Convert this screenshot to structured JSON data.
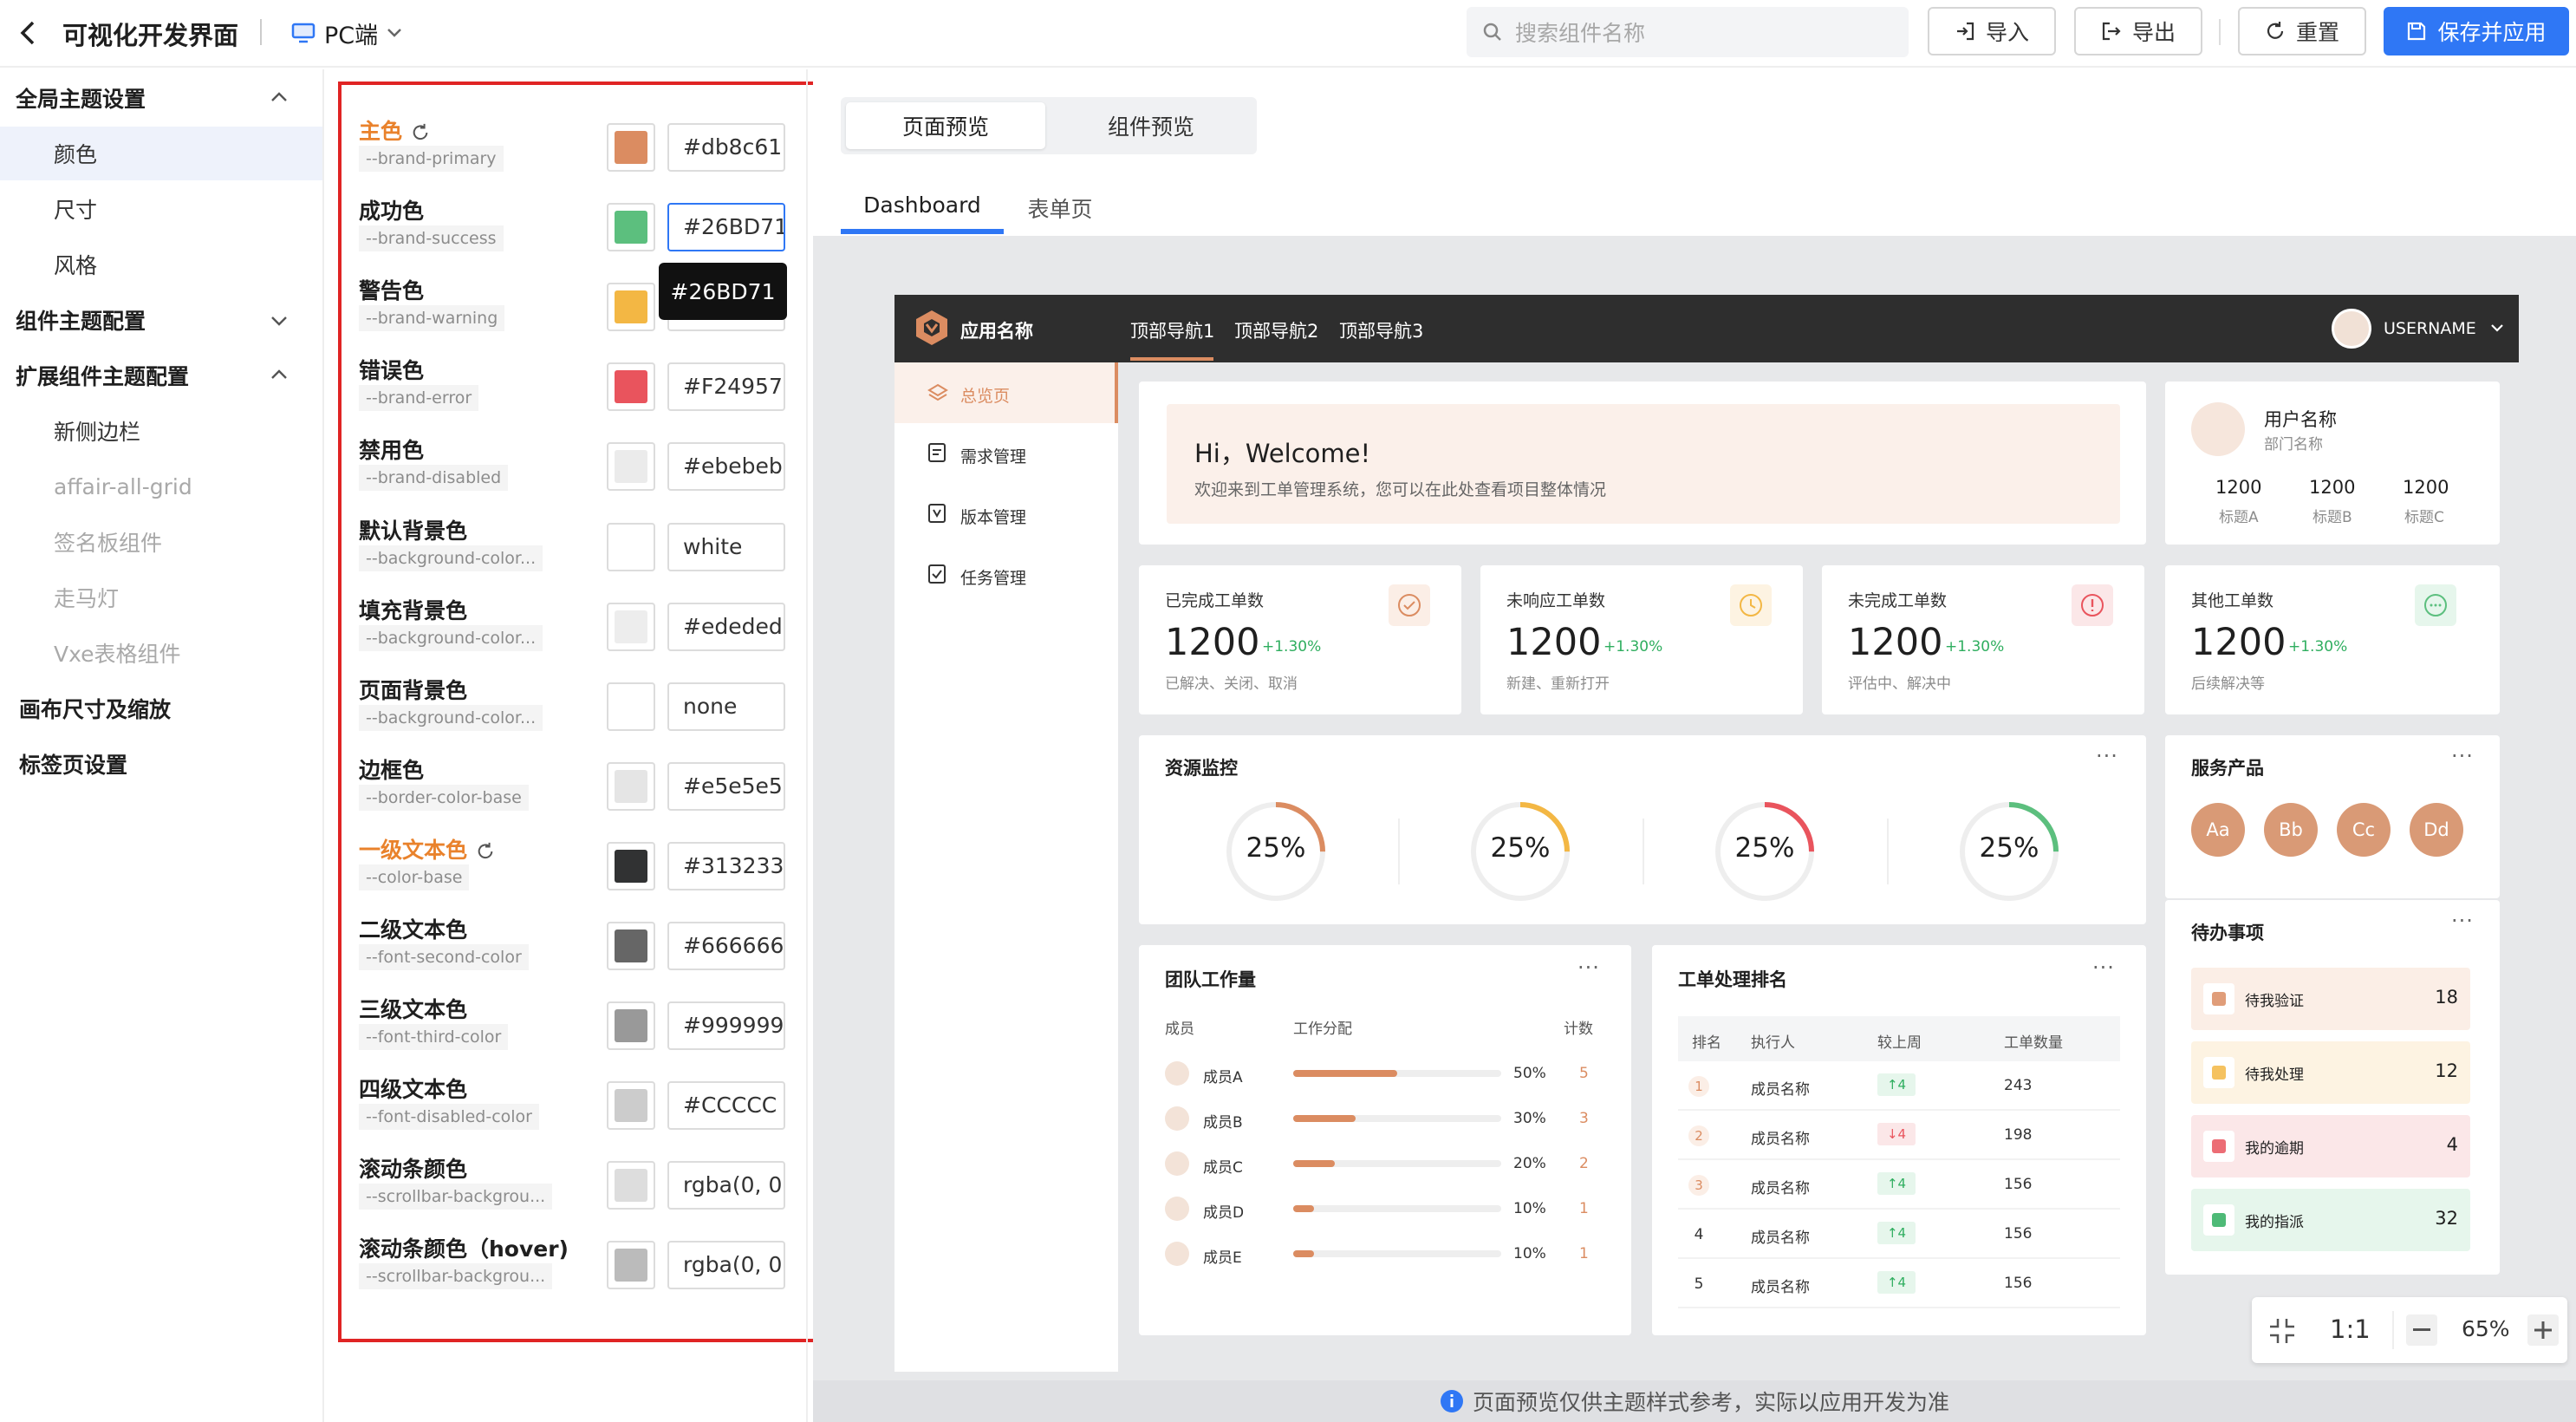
{
  "header": {
    "title": "可视化开发界面",
    "platform": "PC端",
    "search_placeholder": "搜索组件名称",
    "import_label": "导入",
    "export_label": "导出",
    "reset_label": "重置",
    "save_label": "保存并应用"
  },
  "sidebar": {
    "items": [
      {
        "label": "全局主题设置"
      },
      {
        "label": "颜色"
      },
      {
        "label": "尺寸"
      },
      {
        "label": "风格"
      },
      {
        "label": "组件主题配置"
      },
      {
        "label": "扩展组件主题配置"
      },
      {
        "label": "新侧边栏"
      },
      {
        "label": "affair-all-grid"
      },
      {
        "label": "签名板组件"
      },
      {
        "label": "走马灯"
      },
      {
        "label": "Vxe表格组件"
      },
      {
        "label": "画布尺寸及缩放"
      },
      {
        "label": "标签页设置"
      }
    ]
  },
  "theme": {
    "rows": [
      {
        "label": "主色",
        "var": "--brand-primary",
        "value": "#db8c61",
        "color": "#db8c61"
      },
      {
        "label": "成功色",
        "var": "--brand-success",
        "value": "#26BD71",
        "color": "#5cbf7e"
      },
      {
        "label": "警告色",
        "var": "--brand-warning",
        "value": "",
        "color": "#f3b744"
      },
      {
        "label": "错误色",
        "var": "--brand-error",
        "value": "#F24957",
        "color": "#e9545d"
      },
      {
        "label": "禁用色",
        "var": "--brand-disabled",
        "value": "#ebebeb",
        "color": "#ebebeb"
      },
      {
        "label": "默认背景色",
        "var": "--background-color...",
        "value": "white",
        "color": "#ffffff"
      },
      {
        "label": "填充背景色",
        "var": "--background-color...",
        "value": "#ededed",
        "color": "#ededed"
      },
      {
        "label": "页面背景色",
        "var": "--background-color...",
        "value": "none",
        "color": "#ffffff"
      },
      {
        "label": "边框色",
        "var": "--border-color-base",
        "value": "#e5e5e5",
        "color": "#e5e5e5"
      },
      {
        "label": "一级文本色",
        "var": "--color-base",
        "value": "#313233",
        "color": "#313233"
      },
      {
        "label": "二级文本色",
        "var": "--font-second-color",
        "value": "#666666",
        "color": "#666666"
      },
      {
        "label": "三级文本色",
        "var": "--font-third-color",
        "value": "#999999",
        "color": "#999999"
      },
      {
        "label": "四级文本色",
        "var": "--font-disabled-color",
        "value": "#CCCCC",
        "color": "#cccccc"
      },
      {
        "label": "滚动条颜色",
        "var": "--scrollbar-backgrou...",
        "value": "rgba(0, 0",
        "color": "#dddddd"
      },
      {
        "label": "滚动条颜色（hover)",
        "var": "--scrollbar-backgrou...",
        "value": "rgba(0, 0",
        "color": "#bbbbbb"
      }
    ],
    "tooltip": "#26BD71"
  },
  "preview": {
    "seg_page": "页面预览",
    "seg_component": "组件预览",
    "tab_dashboard": "Dashboard",
    "tab_form": "表单页",
    "notice": "页面预览仅供主题样式参考，实际以应用开发为准",
    "zoom_ratio": "1:1",
    "zoom_level": "65%"
  },
  "app": {
    "name": "应用名称",
    "nav": [
      "顶部导航1",
      "顶部导航2",
      "顶部导航3"
    ],
    "username": "USERNAME",
    "menu": [
      "总览页",
      "需求管理",
      "版本管理",
      "任务管理"
    ],
    "welcome_title": "Hi，Welcome!",
    "welcome_sub": "欢迎来到工单管理系统，您可以在此处查看项目整体情况",
    "user_name": "用户名称",
    "dept": "部门名称",
    "user_stats": [
      {
        "value": "1200",
        "label": "标题A"
      },
      {
        "value": "1200",
        "label": "标题B"
      },
      {
        "value": "1200",
        "label": "标题C"
      }
    ],
    "stats": [
      {
        "title": "已完成工单数",
        "value": "1200",
        "delta": "+1.30%",
        "sub": "已解决、关闭、取消"
      },
      {
        "title": "未响应工单数",
        "value": "1200",
        "delta": "+1.30%",
        "sub": "新建、重新打开"
      },
      {
        "title": "未完成工单数",
        "value": "1200",
        "delta": "+1.30%",
        "sub": "评估中、解决中"
      },
      {
        "title": "其他工单数",
        "value": "1200",
        "delta": "+1.30%",
        "sub": "后续解决等"
      }
    ],
    "resource_title": "资源监控",
    "gauges": [
      {
        "value": "25%",
        "pct": 25
      },
      {
        "value": "25%",
        "pct": 25
      },
      {
        "value": "25%",
        "pct": 25
      },
      {
        "value": "25%",
        "pct": 25
      }
    ],
    "services_title": "服务产品",
    "services": [
      "Aa",
      "Bb",
      "Cc",
      "Dd"
    ],
    "team_title": "团队工作量",
    "team_headers": [
      "成员",
      "工作分配",
      "计数"
    ],
    "team": [
      {
        "name": "成员A",
        "pct": "50%",
        "fill": 0.5,
        "count": "5"
      },
      {
        "name": "成员B",
        "pct": "30%",
        "fill": 0.3,
        "count": "3"
      },
      {
        "name": "成员C",
        "pct": "20%",
        "fill": 0.2,
        "count": "2"
      },
      {
        "name": "成员D",
        "pct": "10%",
        "fill": 0.1,
        "count": "1"
      },
      {
        "name": "成员E",
        "pct": "10%",
        "fill": 0.1,
        "count": "1"
      }
    ],
    "rank_title": "工单处理排名",
    "rank_headers": [
      "排名",
      "执行人",
      "较上周",
      "工单数量"
    ],
    "rank": [
      {
        "rank": "1",
        "name": "成员名称",
        "trend": "↑4",
        "up": true,
        "count": "243"
      },
      {
        "rank": "2",
        "name": "成员名称",
        "trend": "↓4",
        "up": false,
        "count": "198"
      },
      {
        "rank": "3",
        "name": "成员名称",
        "trend": "↑4",
        "up": true,
        "count": "156"
      },
      {
        "rank": "4",
        "name": "成员名称",
        "trend": "↑4",
        "up": true,
        "count": "156"
      },
      {
        "rank": "5",
        "name": "成员名称",
        "trend": "↑4",
        "up": true,
        "count": "156"
      }
    ],
    "todo_title": "待办事项",
    "todos": [
      {
        "label": "待我验证",
        "count": "18",
        "bg": "#fbeee6"
      },
      {
        "label": "待我处理",
        "count": "12",
        "bg": "#fdf3e2"
      },
      {
        "label": "我的逾期",
        "count": "4",
        "bg": "#fbe7e8"
      },
      {
        "label": "我的指派",
        "count": "32",
        "bg": "#e6f6ec"
      }
    ]
  },
  "colors": {
    "accent": "#2f77f5",
    "brand": "#db8c61",
    "success": "#26BD71",
    "warning": "#f3b744",
    "error": "#F24957",
    "panel_border": "#e02424"
  }
}
